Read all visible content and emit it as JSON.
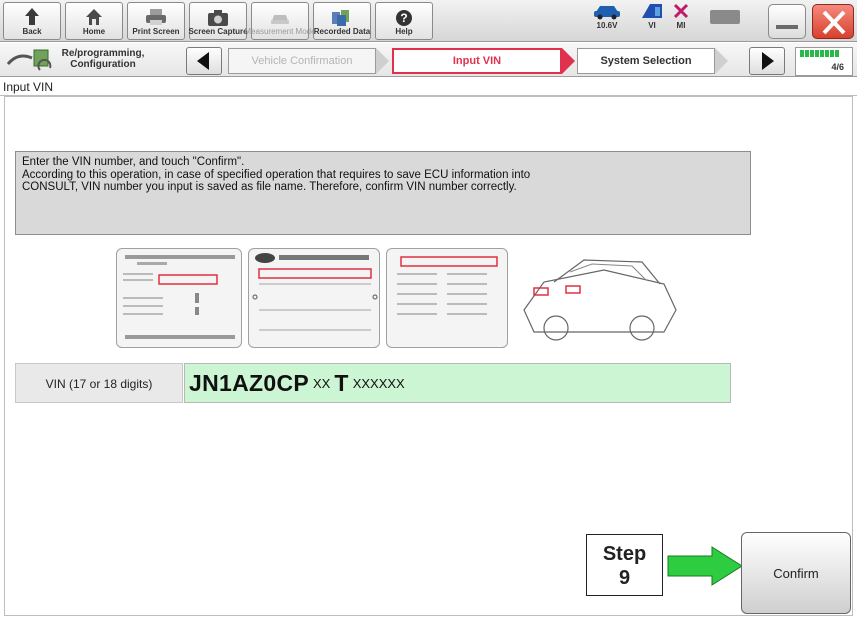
{
  "toolbar": {
    "back": "Back",
    "home": "Home",
    "print_screen": "Print Screen",
    "screen_capture": "Screen Capture",
    "measurement_mode": "Measurement Mode",
    "recorded_data": "Recorded Data",
    "help": "Help"
  },
  "status": {
    "voltage": "10.6V",
    "vi": "VI",
    "mi": "MI"
  },
  "breadcrumb": {
    "section": "Re/programming, Configuration",
    "steps": [
      {
        "label": "Vehicle Confirmation",
        "state": "inactive"
      },
      {
        "label": "Input VIN",
        "state": "active"
      },
      {
        "label": "System Selection",
        "state": "next"
      }
    ],
    "page": "4/6"
  },
  "screen_title": "Input VIN",
  "instructions": [
    "Enter the VIN number, and touch \"Confirm\".",
    "According to this operation, in case of specified operation that requires to save ECU information into",
    "CONSULT, VIN number you input is saved as file name. Therefore, confirm VIN number correctly."
  ],
  "vin": {
    "label": "VIN (17 or 18 digits)",
    "part1": "JN1AZ0CP",
    "part2": "XX",
    "part3": "T",
    "part4": "XXXXXX"
  },
  "callout": {
    "line1": "Step",
    "line2": "9"
  },
  "confirm_label": "Confirm",
  "colors": {
    "active_step": "#e0314f",
    "vin_field_bg": "#ccf5d3",
    "arrow_green": "#2ecc40",
    "battery_green": "#29b84a"
  }
}
